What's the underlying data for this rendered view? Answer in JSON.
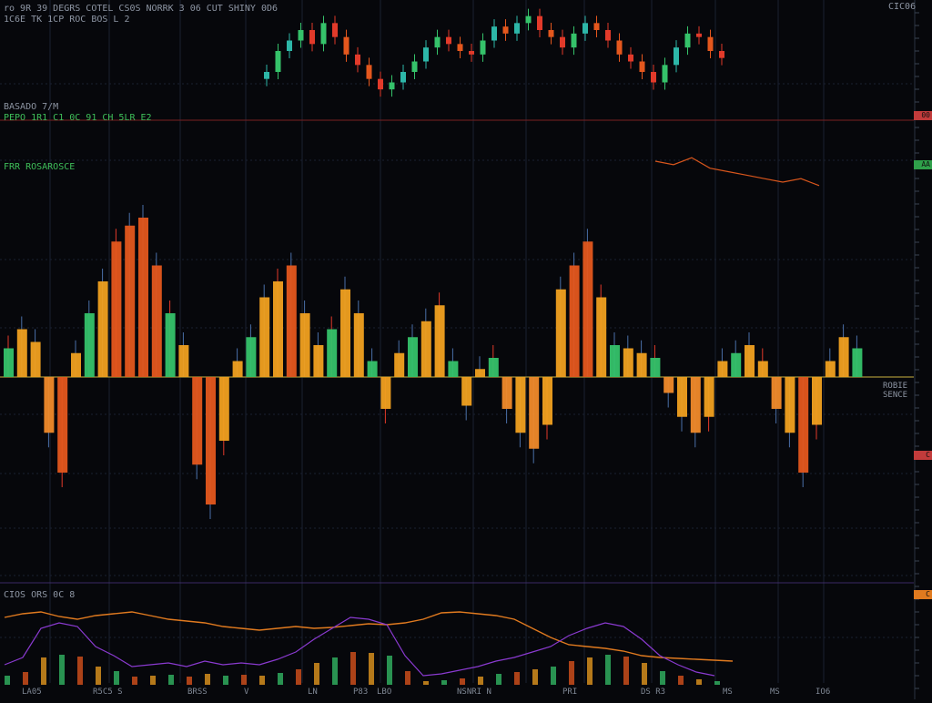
{
  "header": {
    "line1": "ro 9R 39 DEGRS  COTEL CS0S NORRK  3 06 CUT SHINY 0D6",
    "line2": "1C6E  TK  1CP  ROC BOS L 2"
  },
  "top_right_label": "CIC06",
  "panel_labels": {
    "p1_title": "BASADO 7/M",
    "p1_sub": "PEPO 1R1 C1 0C 91 CH 5LR E2",
    "p2_title": "FRR ROSAROSCE",
    "mid_right_1": "ROBIE",
    "mid_right_2": "SENCE",
    "p3_title": "CIOS ORS 0C 8"
  },
  "right_tags": [
    {
      "text": "00",
      "color": "#c23b3b"
    },
    {
      "text": "AA",
      "color": "#2fa04a"
    },
    {
      "text": "C",
      "color": "#c23b3b"
    },
    {
      "text": "C",
      "color": "#e07a1f"
    }
  ],
  "x_ticks": [
    "LA05",
    "R5C5 S",
    "BRSS",
    "V",
    "LN",
    "P83",
    "LBO",
    "NSNRI  N",
    "PRI",
    "DS R3",
    "MS",
    "MS",
    "IO6"
  ],
  "colors": {
    "bg": "#06070b",
    "grid": "#1a2130",
    "up": "#f0a020",
    "down": "#e4571d",
    "green": "#35c26a",
    "teal": "#2db7a8",
    "red": "#e23a2a"
  },
  "chart_data": [
    {
      "type": "candlestick",
      "panel": "top",
      "series": [
        {
          "name": "",
          "values": [
            52,
            58,
            61,
            64,
            60,
            66,
            62,
            57,
            54,
            50,
            47,
            49,
            52,
            55,
            59,
            62,
            60,
            58,
            57,
            61,
            65,
            63,
            66,
            68,
            64,
            62,
            59,
            63,
            66,
            64,
            61,
            57,
            55,
            52,
            49,
            54,
            59,
            63,
            62,
            58,
            56
          ]
        },
        {
          "name": "",
          "values": [
            40,
            39,
            41,
            38,
            37,
            36,
            35,
            34,
            35,
            33
          ]
        }
      ]
    },
    {
      "type": "bar",
      "panel": "middle",
      "series": [
        {
          "name": "",
          "values": [
            18,
            30,
            22,
            -35,
            -60,
            15,
            40,
            60,
            85,
            95,
            100,
            70,
            40,
            20,
            -55,
            -80,
            -40,
            10,
            25,
            50,
            60,
            70,
            40,
            20,
            30,
            55,
            40,
            10,
            -20,
            15,
            25,
            35,
            45,
            10,
            -18,
            5,
            12,
            -20,
            -35,
            -45,
            -30,
            55,
            70,
            85,
            50,
            20,
            18,
            15,
            12,
            -10,
            -25,
            -35,
            -25,
            10,
            15,
            20,
            10,
            -20,
            -35,
            -60,
            -30,
            10,
            25,
            18
          ]
        }
      ]
    },
    {
      "type": "line",
      "panel": "bottom",
      "series": [
        {
          "name": "",
          "values": [
            72,
            76,
            78,
            73,
            70,
            74,
            76,
            78,
            74,
            70,
            68,
            66,
            62,
            60,
            58,
            60,
            62,
            60,
            61,
            63,
            65,
            64,
            66,
            70,
            77,
            78,
            76,
            74,
            70,
            60,
            50,
            42,
            40,
            38,
            35,
            30,
            28,
            27,
            26,
            25,
            24
          ]
        },
        {
          "name": "",
          "values": [
            20,
            28,
            60,
            66,
            62,
            40,
            30,
            18,
            20,
            22,
            18,
            24,
            20,
            22,
            20,
            26,
            34,
            48,
            60,
            72,
            70,
            64,
            30,
            8,
            10,
            14,
            18,
            24,
            28,
            34,
            40,
            52,
            60,
            66,
            62,
            48,
            30,
            20,
            12,
            8
          ]
        }
      ]
    }
  ]
}
